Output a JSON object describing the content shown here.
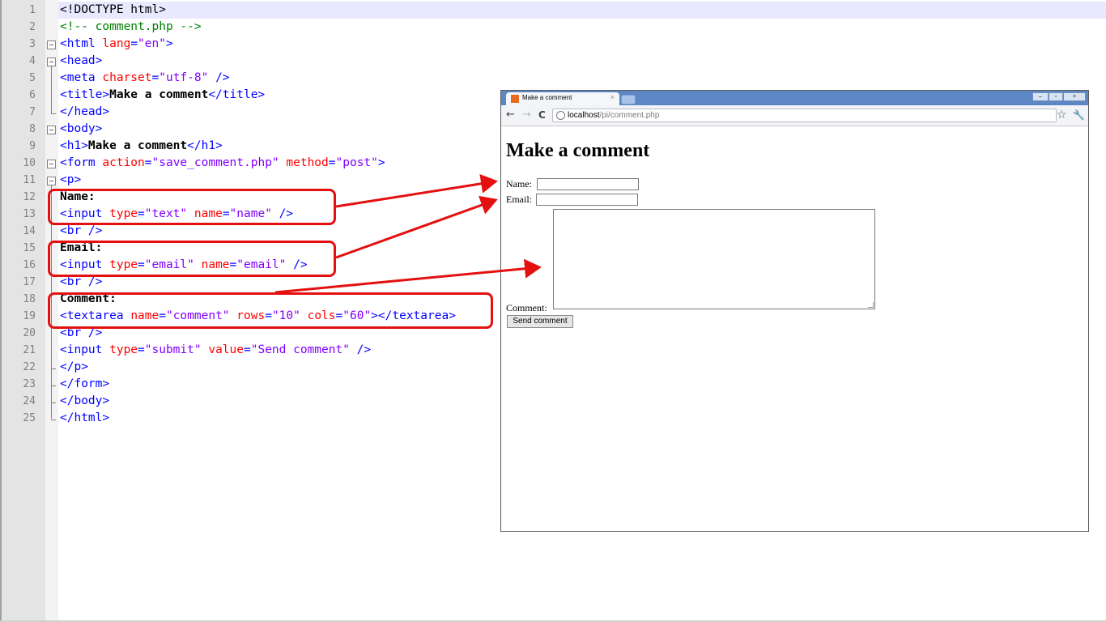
{
  "editor": {
    "line_numbers": [
      "1",
      "2",
      "3",
      "4",
      "5",
      "6",
      "7",
      "8",
      "9",
      "10",
      "11",
      "12",
      "13",
      "14",
      "15",
      "16",
      "17",
      "18",
      "19",
      "20",
      "21",
      "22",
      "23",
      "24",
      "25"
    ],
    "lines": [
      [
        {
          "t": "<!DOCTYPE html>",
          "c": "txt0"
        }
      ],
      [
        {
          "t": "<!-- comment.php -->",
          "c": "cmt"
        }
      ],
      [
        {
          "t": "<html ",
          "c": "tag"
        },
        {
          "t": "lang",
          "c": "attr"
        },
        {
          "t": "=",
          "c": "tag"
        },
        {
          "t": "\"en\"",
          "c": "val"
        },
        {
          "t": ">",
          "c": "tag"
        }
      ],
      [
        {
          "t": "<head>",
          "c": "tag"
        }
      ],
      [
        {
          "t": "<meta ",
          "c": "tag"
        },
        {
          "t": "charset",
          "c": "attr"
        },
        {
          "t": "=",
          "c": "tag"
        },
        {
          "t": "\"utf-8\"",
          "c": "val"
        },
        {
          "t": " />",
          "c": "tag"
        }
      ],
      [
        {
          "t": "<title>",
          "c": "tag"
        },
        {
          "t": "Make a comment",
          "c": "txt"
        },
        {
          "t": "</title>",
          "c": "tag"
        }
      ],
      [
        {
          "t": "</head>",
          "c": "tag"
        }
      ],
      [
        {
          "t": "<body>",
          "c": "tag"
        }
      ],
      [
        {
          "t": "<h1>",
          "c": "tag"
        },
        {
          "t": "Make a comment",
          "c": "txt"
        },
        {
          "t": "</h1>",
          "c": "tag"
        }
      ],
      [
        {
          "t": "<form ",
          "c": "tag"
        },
        {
          "t": "action",
          "c": "attr"
        },
        {
          "t": "=",
          "c": "tag"
        },
        {
          "t": "\"save_comment.php\"",
          "c": "val"
        },
        {
          "t": " ",
          "c": "tag"
        },
        {
          "t": "method",
          "c": "attr"
        },
        {
          "t": "=",
          "c": "tag"
        },
        {
          "t": "\"post\"",
          "c": "val"
        },
        {
          "t": ">",
          "c": "tag"
        }
      ],
      [
        {
          "t": "<p>",
          "c": "tag"
        }
      ],
      [
        {
          "t": "Name:",
          "c": "txt"
        }
      ],
      [
        {
          "t": "<input ",
          "c": "tag"
        },
        {
          "t": "type",
          "c": "attr"
        },
        {
          "t": "=",
          "c": "tag"
        },
        {
          "t": "\"text\"",
          "c": "val"
        },
        {
          "t": " ",
          "c": "tag"
        },
        {
          "t": "name",
          "c": "attr"
        },
        {
          "t": "=",
          "c": "tag"
        },
        {
          "t": "\"name\"",
          "c": "val"
        },
        {
          "t": " />",
          "c": "tag"
        }
      ],
      [
        {
          "t": "<br />",
          "c": "tag"
        }
      ],
      [
        {
          "t": "Email:",
          "c": "txt"
        }
      ],
      [
        {
          "t": "<input ",
          "c": "tag"
        },
        {
          "t": "type",
          "c": "attr"
        },
        {
          "t": "=",
          "c": "tag"
        },
        {
          "t": "\"email\"",
          "c": "val"
        },
        {
          "t": " ",
          "c": "tag"
        },
        {
          "t": "name",
          "c": "attr"
        },
        {
          "t": "=",
          "c": "tag"
        },
        {
          "t": "\"email\"",
          "c": "val"
        },
        {
          "t": " />",
          "c": "tag"
        }
      ],
      [
        {
          "t": "<br />",
          "c": "tag"
        }
      ],
      [
        {
          "t": "Comment:",
          "c": "txt"
        }
      ],
      [
        {
          "t": "<textarea ",
          "c": "tag"
        },
        {
          "t": "name",
          "c": "attr"
        },
        {
          "t": "=",
          "c": "tag"
        },
        {
          "t": "\"comment\"",
          "c": "val"
        },
        {
          "t": " ",
          "c": "tag"
        },
        {
          "t": "rows",
          "c": "attr"
        },
        {
          "t": "=",
          "c": "tag"
        },
        {
          "t": "\"10\"",
          "c": "val"
        },
        {
          "t": " ",
          "c": "tag"
        },
        {
          "t": "cols",
          "c": "attr"
        },
        {
          "t": "=",
          "c": "tag"
        },
        {
          "t": "\"60\"",
          "c": "val"
        },
        {
          "t": "></textarea>",
          "c": "tag"
        }
      ],
      [
        {
          "t": "<br />",
          "c": "tag"
        }
      ],
      [
        {
          "t": "<input ",
          "c": "tag"
        },
        {
          "t": "type",
          "c": "attr"
        },
        {
          "t": "=",
          "c": "tag"
        },
        {
          "t": "\"submit\"",
          "c": "val"
        },
        {
          "t": " ",
          "c": "tag"
        },
        {
          "t": "value",
          "c": "attr"
        },
        {
          "t": "=",
          "c": "tag"
        },
        {
          "t": "\"Send comment\"",
          "c": "val"
        },
        {
          "t": " />",
          "c": "tag"
        }
      ],
      [
        {
          "t": "</p>",
          "c": "tag"
        }
      ],
      [
        {
          "t": "</form>",
          "c": "tag"
        }
      ],
      [
        {
          "t": "</body>",
          "c": "tag"
        }
      ],
      [
        {
          "t": "</html>",
          "c": "tag"
        }
      ]
    ],
    "colors": {
      "tag": "#0000ff",
      "attr": "#ff0000",
      "value": "#8000ff",
      "comment": "#008000",
      "highlight": "#e41010"
    }
  },
  "browser": {
    "tab_title": "Make a comment",
    "tab_close": "×",
    "url_host": "localhost",
    "url_path": "/pi/comment.php",
    "back_icon": "←",
    "forward_icon": "→",
    "reload_icon": "C",
    "star_icon": "☆",
    "wrench_icon": "🔧",
    "minimize": "–",
    "restore": "▫",
    "close": "×",
    "page": {
      "heading": "Make a comment",
      "name_label": "Name:",
      "email_label": "Email:",
      "comment_label": "Comment:",
      "submit_label": "Send comment"
    }
  }
}
